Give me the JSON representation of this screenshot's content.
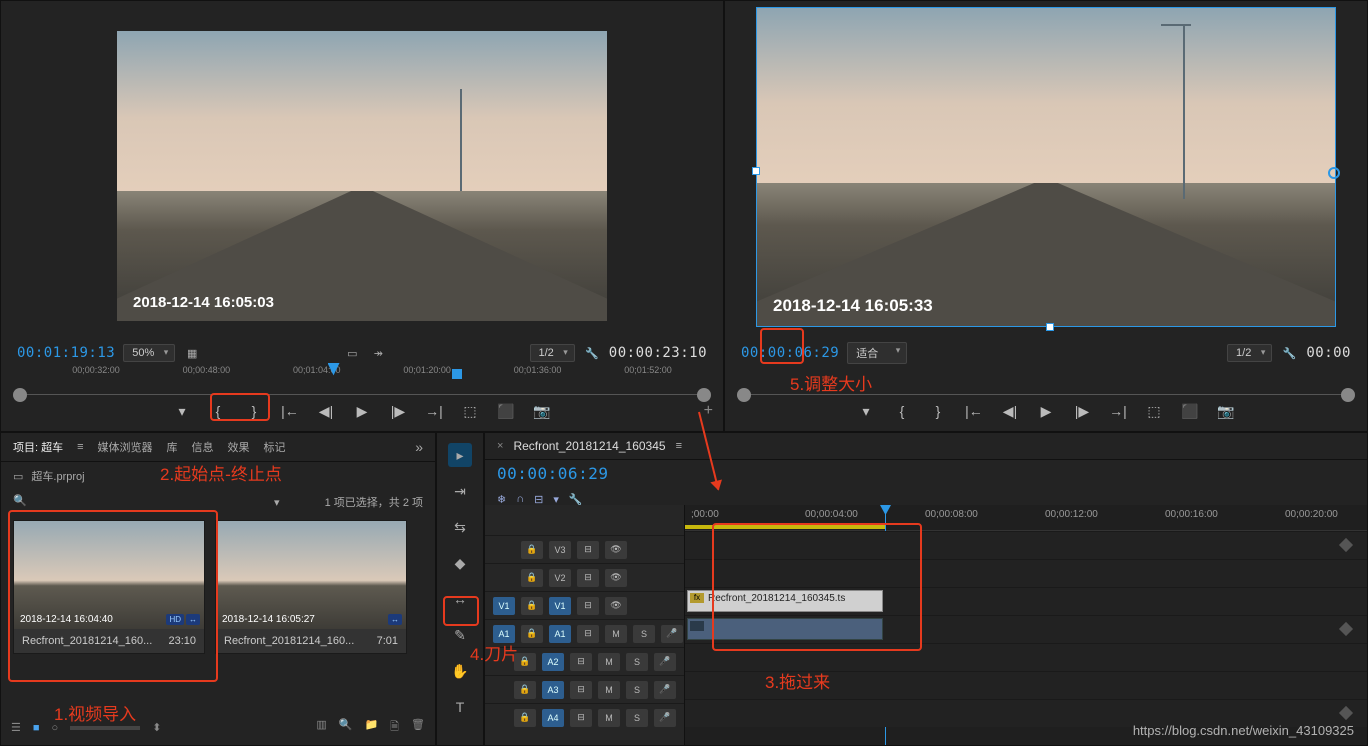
{
  "source": {
    "overlay_ts": "2018-12-14 16:05:03",
    "tc_left": "00:01:19:13",
    "zoom": "50%",
    "res": "1/2",
    "tc_right": "00:00:23:10",
    "ticks": [
      "00;00:32:00",
      "00;00:48:00",
      "00;01:04:00",
      "00;01:20:00",
      "00;01:36:00",
      "00;01:52:00"
    ]
  },
  "program": {
    "overlay_ts": "2018-12-14 16:05:33",
    "tc_left": "00:00:06:29",
    "fit": "适合",
    "res": "1/2",
    "tc_right": "00:00"
  },
  "project": {
    "tabs": [
      "项目: 超车",
      "媒体浏览器",
      "库",
      "信息",
      "效果",
      "标记"
    ],
    "file": "超车.prproj",
    "status": "1 项已选择，共 2 项",
    "clips": [
      {
        "thumb_ts": "2018-12-14 16:04:40",
        "name": "Recfront_20181214_160...",
        "dur": "23:10",
        "badges": [
          "HD",
          "↔"
        ]
      },
      {
        "thumb_ts": "2018-12-14 16:05:27",
        "name": "Recfront_20181214_160...",
        "dur": "7:01",
        "badges": [
          "↔"
        ]
      }
    ]
  },
  "timeline": {
    "seq": "Recfront_20181214_160345",
    "tc": "00:00:06:29",
    "ticks": [
      ";00:00",
      "00;00:04:00",
      "00;00:08:00",
      "00;00:12:00",
      "00;00:16:00",
      "00;00:20:00"
    ],
    "v_tracks": [
      "V3",
      "V2",
      "V1"
    ],
    "a_tracks": [
      "A1",
      "A2",
      "A3",
      "A4"
    ],
    "v_src": "V1",
    "a_src": "A1",
    "clip_name": "Recfront_20181214_160345.ts"
  },
  "annotations": {
    "a1": "1.视频导入",
    "a2": "2.起始点-终止点",
    "a3": "3.拖过来",
    "a4": "4.刀片",
    "a5": "5.调整大小"
  },
  "watermark": "https://blog.csdn.net/weixin_43109325"
}
